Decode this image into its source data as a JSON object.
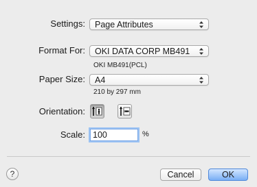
{
  "settings": {
    "label": "Settings:",
    "value": "Page Attributes"
  },
  "format_for": {
    "label": "Format For:",
    "value": "OKI DATA CORP MB491",
    "sub": "OKI MB491(PCL)"
  },
  "paper_size": {
    "label": "Paper Size:",
    "value": "A4",
    "sub": "210 by 297 mm"
  },
  "orientation": {
    "label": "Orientation:",
    "selected": "portrait"
  },
  "scale": {
    "label": "Scale:",
    "value": "100",
    "unit": "%"
  },
  "footer": {
    "help_label": "?",
    "cancel_label": "Cancel",
    "ok_label": "OK"
  },
  "colors": {
    "background": "#ececec",
    "accent": "#79aef5",
    "focus_ring": "#9cc3f3"
  }
}
